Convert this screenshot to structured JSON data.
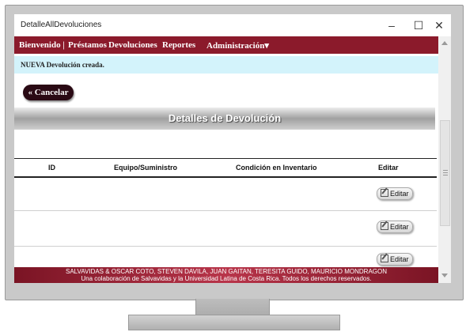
{
  "window": {
    "title": "DetalleAllDevoluciones"
  },
  "nav": {
    "items": [
      "Bienvenido |",
      "Préstamos",
      "Devoluciones",
      "Reportes",
      "Administración"
    ],
    "dropdown_arrow": "▾"
  },
  "notice": "NUEVA Devolución creada.",
  "cancel_label": "« Cancelar",
  "banner_title": "Detalles de Devolución",
  "table": {
    "headers": [
      "ID",
      "Equipo/Suministro",
      "Condición en Inventario",
      "Editar"
    ],
    "edit_label": "Editar",
    "rows": 3
  },
  "footer": {
    "line1": "SALVAVIDAS & OSCAR COTO, STEVEN DAVILA, JUAN GAITAN, TERESITA GUIDO, MAURICIO MONDRAGON",
    "line2": "Una colaboración de Salvavidas y la Universidad Latina de Costa Rica. Todos los derechos reservados."
  },
  "colors": {
    "navbar": "#8b1a2b",
    "notice_bg": "#d3f3fb",
    "cancel_bg": "#2a0a14"
  },
  "icons": [
    "minimize-icon",
    "maximize-icon",
    "close-icon",
    "edit-icon",
    "scroll-up-icon",
    "scroll-down-icon"
  ]
}
